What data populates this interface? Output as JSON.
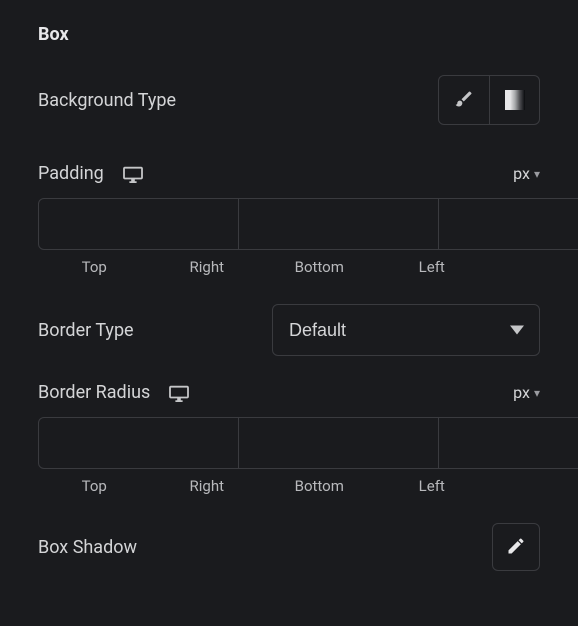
{
  "section_title": "Box",
  "background_type": {
    "label": "Background Type"
  },
  "padding": {
    "label": "Padding",
    "unit": "px",
    "sides": {
      "top": "Top",
      "right": "Right",
      "bottom": "Bottom",
      "left": "Left"
    },
    "values": {
      "top": "",
      "right": "",
      "bottom": "",
      "left": ""
    }
  },
  "border_type": {
    "label": "Border Type",
    "selected": "Default"
  },
  "border_radius": {
    "label": "Border Radius",
    "unit": "px",
    "sides": {
      "top": "Top",
      "right": "Right",
      "bottom": "Bottom",
      "left": "Left"
    },
    "values": {
      "top": "",
      "right": "",
      "bottom": "",
      "left": ""
    }
  },
  "box_shadow": {
    "label": "Box Shadow"
  }
}
